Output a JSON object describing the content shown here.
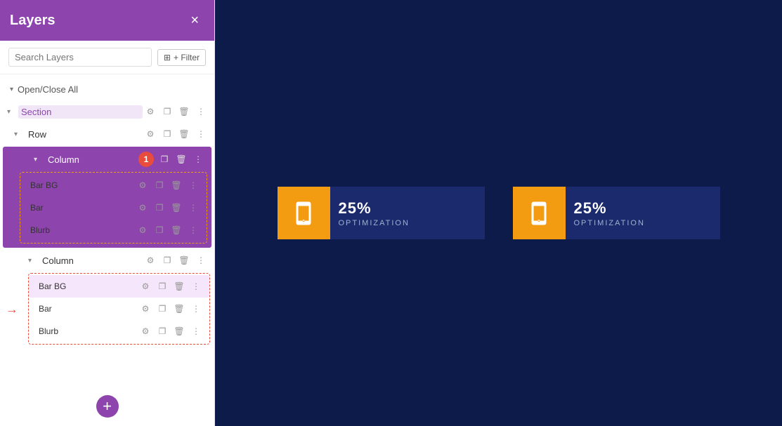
{
  "sidebar": {
    "title": "Layers",
    "close_label": "×",
    "search_placeholder": "Search Layers",
    "filter_label": "+ Filter",
    "open_close_all_label": "Open/Close All",
    "layers": [
      {
        "id": "section",
        "label": "Section",
        "type": "section",
        "indent": 0,
        "expanded": true
      },
      {
        "id": "row",
        "label": "Row",
        "type": "row",
        "indent": 1,
        "expanded": true
      },
      {
        "id": "column1",
        "label": "Column",
        "type": "column",
        "indent": 2,
        "expanded": true,
        "badge": "1",
        "highlighted": true
      },
      {
        "id": "bar-bg-1",
        "label": "Bar BG",
        "type": "child",
        "indent": 3
      },
      {
        "id": "bar-1",
        "label": "Bar",
        "type": "child",
        "indent": 3
      },
      {
        "id": "blurb-1",
        "label": "Blurb",
        "type": "child",
        "indent": 3
      },
      {
        "id": "column2",
        "label": "Column",
        "type": "column",
        "indent": 2,
        "expanded": true,
        "highlighted": false
      },
      {
        "id": "bar-bg-2",
        "label": "Bar BG",
        "type": "child",
        "indent": 3,
        "arrow": true
      },
      {
        "id": "bar-2",
        "label": "Bar",
        "type": "child",
        "indent": 3
      },
      {
        "id": "blurb-2",
        "label": "Blurb",
        "type": "child",
        "indent": 3
      }
    ],
    "add_button_label": "+"
  },
  "canvas": {
    "background_color": "#0d1b4b",
    "cards": [
      {
        "id": "card1",
        "icon": "phone",
        "percent": "25%",
        "label": "OPTIMIZATION"
      },
      {
        "id": "card2",
        "icon": "phone",
        "percent": "25%",
        "label": "OPTIMIZATION"
      }
    ]
  },
  "icons": {
    "gear": "⚙",
    "copy": "❐",
    "trash": "🗑",
    "more": "⋮",
    "chevron_down": "▾",
    "chevron_right": "▸",
    "plus": "+",
    "close": "×",
    "filter": "⊞",
    "arrow_right": "→"
  }
}
